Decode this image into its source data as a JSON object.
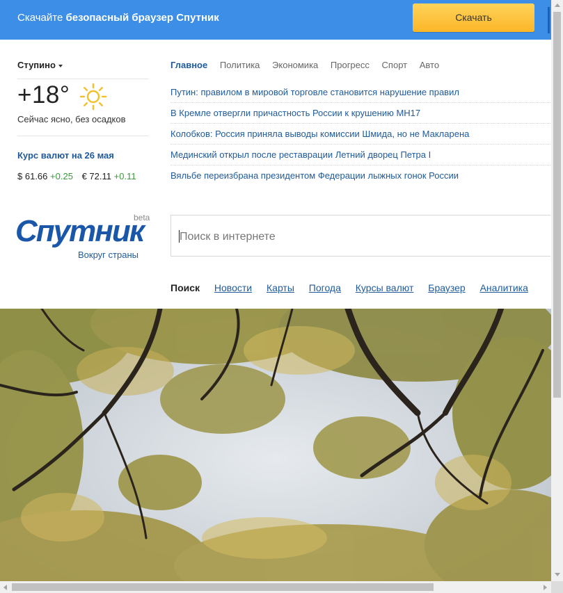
{
  "banner": {
    "text_plain": "Скачайте ",
    "text_bold": "безопасный браузер Спутник",
    "download_label": "Скачать"
  },
  "weather": {
    "city": "Ступино",
    "temperature": "+18°",
    "description": "Сейчас ясно, без осадков",
    "icon": "sun-icon"
  },
  "rates": {
    "title": "Курс валют на 26 мая",
    "usd_symbol": "$",
    "usd_value": "61.66",
    "usd_change": "+0.25",
    "eur_symbol": "€",
    "eur_value": "72.11",
    "eur_change": "+0.11"
  },
  "news": {
    "tabs": [
      "Главное",
      "Политика",
      "Экономика",
      "Прогресс",
      "Спорт",
      "Авто"
    ],
    "items": [
      "Путин: правилом в мировой торговле становится нарушение правил",
      "В Кремле отвергли причастность России к крушению МН17",
      "Колобков: Россия приняла выводы комиссии Шмида, но не Макларена",
      "Мединский открыл после реставрации Летний дворец Петра I",
      "Вяльбе переизбрана президентом Федерации лыжных гонок России"
    ]
  },
  "logo": {
    "word": "Спутник",
    "beta": "beta",
    "tagline": "Вокруг страны"
  },
  "search": {
    "placeholder": "Поиск в интернете"
  },
  "services": [
    "Поиск",
    "Новости",
    "Карты",
    "Погода",
    "Курсы валют",
    "Браузер",
    "Аналитика"
  ],
  "colors": {
    "banner": "#3c8ee6",
    "link": "#1f5a9b",
    "brand": "#1a57a8",
    "positive": "#3a9a3a",
    "button": "#fbb628"
  }
}
